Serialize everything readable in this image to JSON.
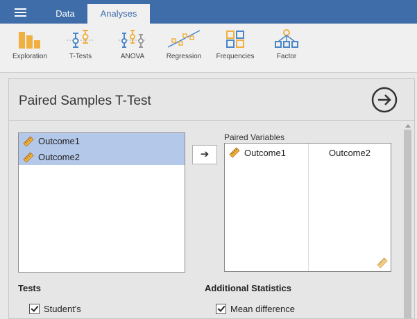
{
  "topbar": {
    "tabs": [
      {
        "label": "Data",
        "active": false
      },
      {
        "label": "Analyses",
        "active": true
      }
    ]
  },
  "ribbon": {
    "items": [
      {
        "label": "Exploration",
        "icon": "exploration-icon"
      },
      {
        "label": "T-Tests",
        "icon": "t-tests-icon"
      },
      {
        "label": "ANOVA",
        "icon": "anova-icon"
      },
      {
        "label": "Regression",
        "icon": "regression-icon"
      },
      {
        "label": "Frequencies",
        "icon": "frequencies-icon"
      },
      {
        "label": "Factor",
        "icon": "factor-icon"
      }
    ]
  },
  "panel": {
    "title": "Paired Samples T-Test",
    "available_variables": [
      {
        "name": "Outcome1",
        "selected": true
      },
      {
        "name": "Outcome2",
        "selected": true
      }
    ],
    "move_button_glyph": "➔",
    "paired_label": "Paired Variables",
    "pairs": [
      {
        "left": "Outcome1",
        "right": "Outcome2"
      }
    ],
    "tests_heading": "Tests",
    "tests": [
      {
        "label": "Student's",
        "checked": true
      }
    ],
    "additional_heading": "Additional Statistics",
    "additional": [
      {
        "label": "Mean difference",
        "checked": true
      }
    ]
  },
  "colors": {
    "accent": "#3e6da9",
    "selection": "#b4c8ea",
    "icon_orange": "#f0b040",
    "icon_blue": "#4a86c8"
  }
}
